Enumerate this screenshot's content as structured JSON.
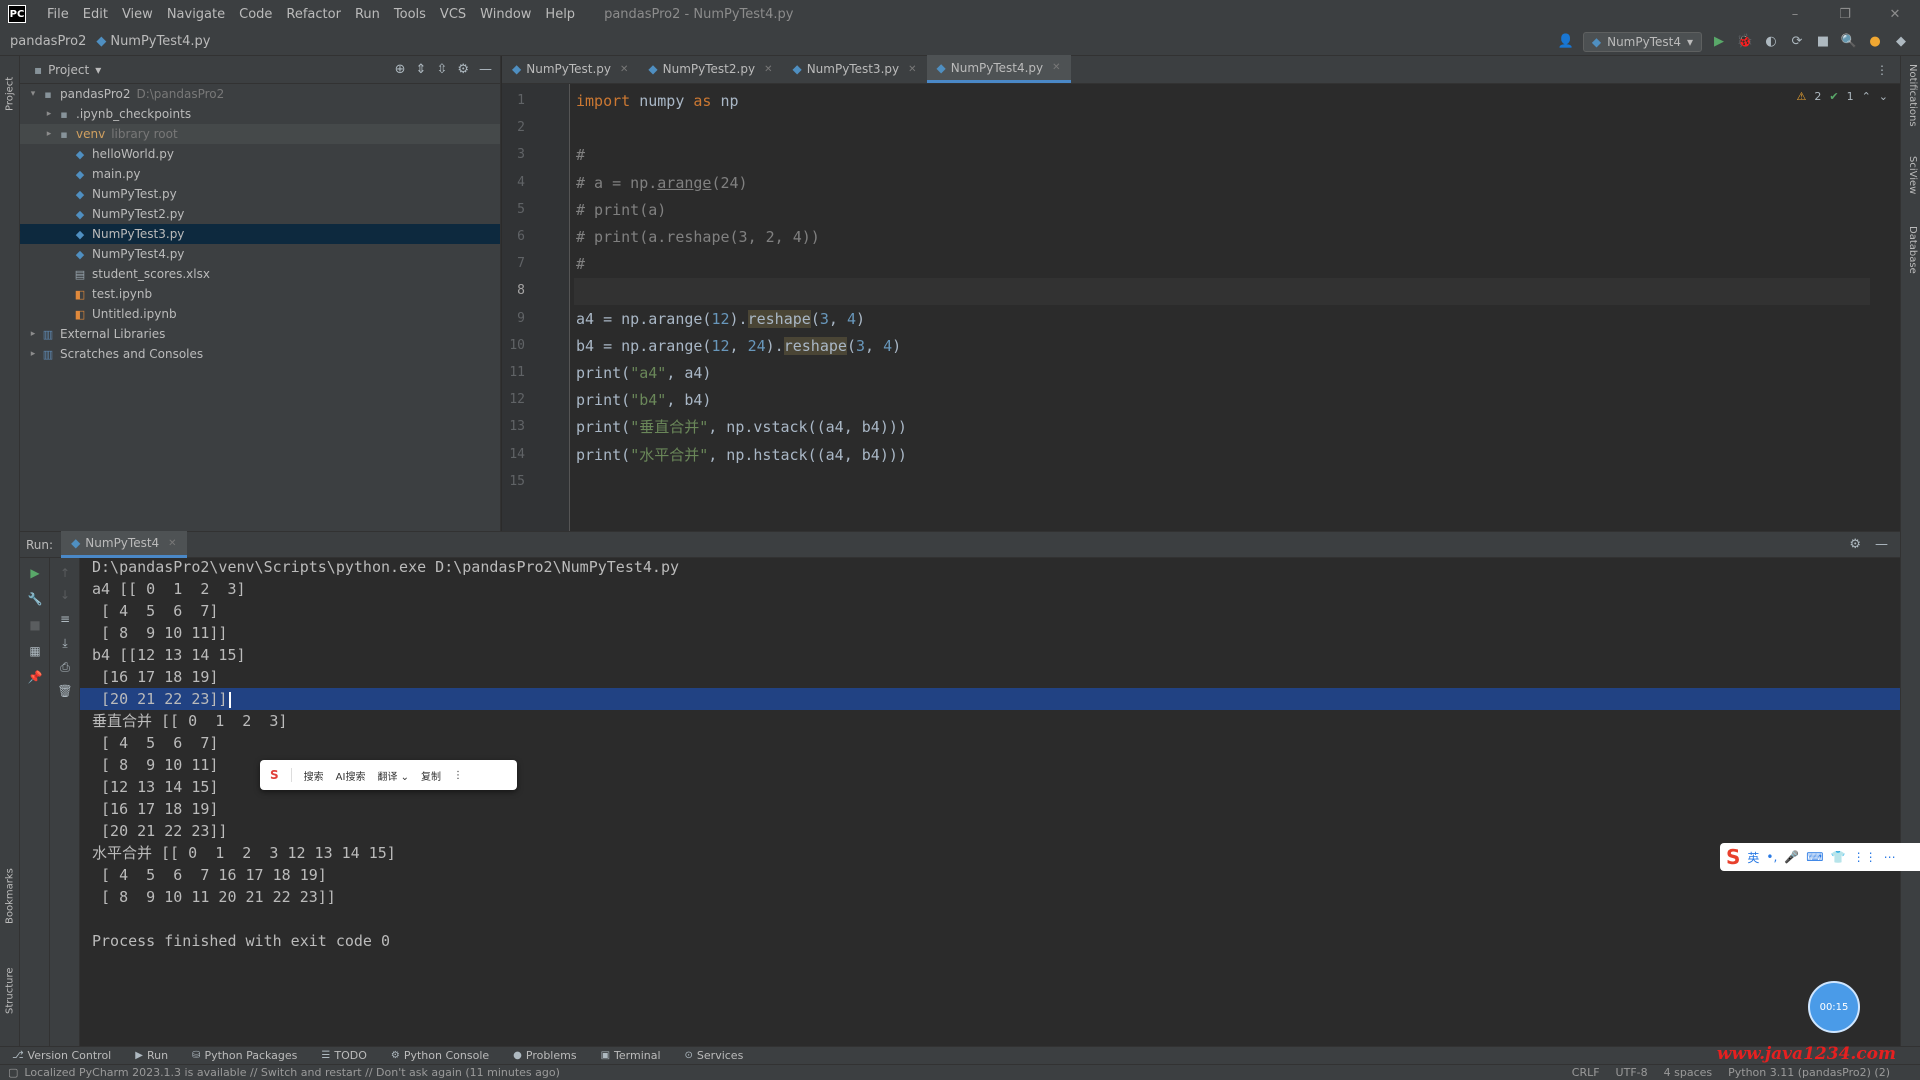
{
  "menubar": {
    "logo": "PC",
    "items": [
      "File",
      "Edit",
      "View",
      "Navigate",
      "Code",
      "Refactor",
      "Run",
      "Tools",
      "VCS",
      "Window",
      "Help"
    ],
    "window_title": "pandasPro2 - NumPyTest4.py",
    "controls": [
      "–",
      "❐",
      "✕"
    ]
  },
  "navbar": {
    "project": "pandasPro2",
    "file": "NumPyTest4.py",
    "run_config": "NumPyTest4"
  },
  "project_panel": {
    "title": "Project",
    "tree": [
      {
        "label": "pandasPro2",
        "hint": "D:\\pandasPro2",
        "depth": 0,
        "arrow": "▾",
        "icon": "folder"
      },
      {
        "label": ".ipynb_checkpoints",
        "depth": 1,
        "arrow": "▸",
        "icon": "folder"
      },
      {
        "label": "venv",
        "hint": "library root",
        "depth": 1,
        "arrow": "▸",
        "icon": "folder"
      },
      {
        "label": "helloWorld.py",
        "depth": 2,
        "icon": "py"
      },
      {
        "label": "main.py",
        "depth": 2,
        "icon": "py"
      },
      {
        "label": "NumPyTest.py",
        "depth": 2,
        "icon": "py"
      },
      {
        "label": "NumPyTest2.py",
        "depth": 2,
        "icon": "py"
      },
      {
        "label": "NumPyTest3.py",
        "depth": 2,
        "icon": "py"
      },
      {
        "label": "NumPyTest4.py",
        "depth": 2,
        "icon": "py"
      },
      {
        "label": "student_scores.xlsx",
        "depth": 2,
        "icon": "xls"
      },
      {
        "label": "test.ipynb",
        "depth": 2,
        "icon": "nb"
      },
      {
        "label": "Untitled.ipynb",
        "depth": 2,
        "icon": "nb"
      },
      {
        "label": "External Libraries",
        "depth": 0,
        "arrow": "▸",
        "icon": "lib"
      },
      {
        "label": "Scratches and Consoles",
        "depth": 0,
        "arrow": "▸",
        "icon": "lib"
      }
    ]
  },
  "editor": {
    "tabs": [
      "NumPyTest.py",
      "NumPyTest2.py",
      "NumPyTest3.py",
      "NumPyTest4.py"
    ],
    "active_tab": 3,
    "inspection": {
      "warnings": "2",
      "ok": "1"
    },
    "lines": [
      {
        "n": "1",
        "tokens": [
          {
            "t": "import",
            "c": "kw"
          },
          {
            "t": " numpy "
          },
          {
            "t": "as",
            "c": "kw"
          },
          {
            "t": " np"
          }
        ]
      },
      {
        "n": "2",
        "tokens": []
      },
      {
        "n": "3",
        "tokens": [
          {
            "t": "#",
            "c": "cm"
          }
        ]
      },
      {
        "n": "4",
        "tokens": [
          {
            "t": "# a = np.",
            "c": "cm"
          },
          {
            "t": "arange",
            "c": "cm und"
          },
          {
            "t": "(24)",
            "c": "cm"
          }
        ]
      },
      {
        "n": "5",
        "tokens": [
          {
            "t": "# print(a)",
            "c": "cm"
          }
        ]
      },
      {
        "n": "6",
        "tokens": [
          {
            "t": "# print(a.reshape(3, 2, 4))",
            "c": "cm"
          }
        ]
      },
      {
        "n": "7",
        "tokens": [
          {
            "t": "#",
            "c": "cm"
          }
        ]
      },
      {
        "n": "8",
        "tokens": [],
        "current": true
      },
      {
        "n": "9",
        "tokens": [
          {
            "t": "a4 = np.arange("
          },
          {
            "t": "12",
            "c": "num"
          },
          {
            "t": ")."
          },
          {
            "t": "reshape",
            "c": "hl"
          },
          {
            "t": "("
          },
          {
            "t": "3",
            "c": "num"
          },
          {
            "t": ", "
          },
          {
            "t": "4",
            "c": "num"
          },
          {
            "t": ")"
          }
        ]
      },
      {
        "n": "10",
        "tokens": [
          {
            "t": "b4 = np.arange("
          },
          {
            "t": "12",
            "c": "num"
          },
          {
            "t": ", "
          },
          {
            "t": "24",
            "c": "num"
          },
          {
            "t": ")."
          },
          {
            "t": "reshape",
            "c": "hl"
          },
          {
            "t": "("
          },
          {
            "t": "3",
            "c": "num"
          },
          {
            "t": ", "
          },
          {
            "t": "4",
            "c": "num"
          },
          {
            "t": ")"
          }
        ]
      },
      {
        "n": "11",
        "tokens": [
          {
            "t": "print("
          },
          {
            "t": "\"a4\"",
            "c": "str"
          },
          {
            "t": ", a4)"
          }
        ]
      },
      {
        "n": "12",
        "tokens": [
          {
            "t": "print("
          },
          {
            "t": "\"b4\"",
            "c": "str"
          },
          {
            "t": ", b4)"
          }
        ]
      },
      {
        "n": "13",
        "tokens": [
          {
            "t": "print("
          },
          {
            "t": "\"垂直合并\"",
            "c": "str"
          },
          {
            "t": ", np.vstack((a4, b4)))"
          }
        ]
      },
      {
        "n": "14",
        "tokens": [
          {
            "t": "print("
          },
          {
            "t": "\"水平合并\"",
            "c": "str"
          },
          {
            "t": ", np.hstack((a4, b4)))"
          }
        ]
      },
      {
        "n": "15",
        "tokens": []
      }
    ]
  },
  "run_panel": {
    "label": "Run:",
    "tab": "NumPyTest4",
    "console": [
      "D:\\pandasPro2\\venv\\Scripts\\python.exe D:\\pandasPro2\\NumPyTest4.py",
      "a4 [[ 0  1  2  3]",
      " [ 4  5  6  7]",
      " [ 8  9 10 11]]",
      "b4 [[12 13 14 15]",
      " [16 17 18 19]",
      " [20 21 22 23]]",
      "垂直合并 [[ 0  1  2  3]",
      " [ 4  5  6  7]",
      " [ 8  9 10 11]",
      " [12 13 14 15]",
      " [16 17 18 19]",
      " [20 21 22 23]]",
      "水平合并 [[ 0  1  2  3 12 13 14 15]",
      " [ 4  5  6  7 16 17 18 19]",
      " [ 8  9 10 11 20 21 22 23]]",
      "",
      "Process finished with exit code 0"
    ],
    "selected_line": 6
  },
  "selection_popup": {
    "logo": "S",
    "items": [
      "搜索",
      "AI搜索",
      "翻译 ⌄",
      "复制",
      "⋮"
    ]
  },
  "ime_bar": {
    "logo": "S",
    "items": [
      "英",
      "•,",
      "🎤",
      "⌨",
      "👕",
      "⋮⋮",
      "⋯"
    ]
  },
  "timer": "00:15",
  "bottom_tools": [
    {
      "icon": "⎇",
      "label": "Version Control"
    },
    {
      "icon": "▶",
      "label": "Run"
    },
    {
      "icon": "⛁",
      "label": "Python Packages"
    },
    {
      "icon": "☰",
      "label": "TODO"
    },
    {
      "icon": "⚙",
      "label": "Python Console"
    },
    {
      "icon": "●",
      "label": "Problems"
    },
    {
      "icon": "▣",
      "label": "Terminal"
    },
    {
      "icon": "⊙",
      "label": "Services"
    }
  ],
  "watermark": "www.java1234.com",
  "statusbar": {
    "message": "Localized PyCharm 2023.1.3 is available // Switch and restart // Don't ask again (11 minutes ago)",
    "items": [
      "CRLF",
      "UTF-8",
      "4 spaces",
      "Python 3.11 (pandasPro2) (2)"
    ]
  },
  "stripes": {
    "left": [
      "Project",
      "Bookmarks",
      "Structure"
    ],
    "right": [
      "Notifications",
      "SciView",
      "Database"
    ]
  }
}
